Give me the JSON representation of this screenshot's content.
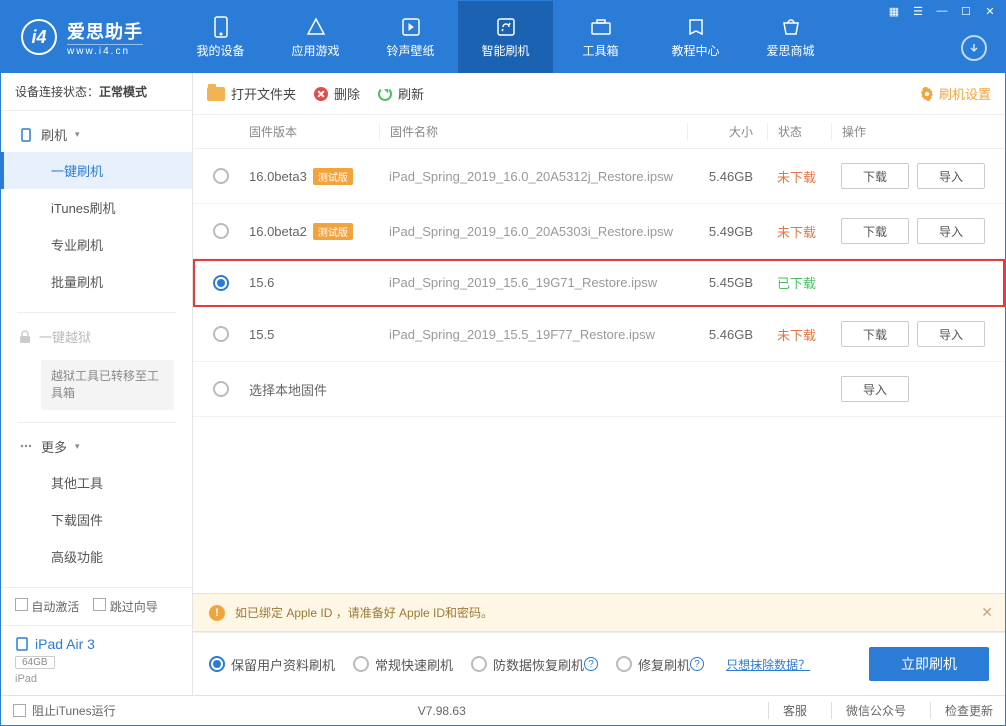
{
  "header": {
    "logo_abbr": "i4",
    "logo_cn": "爱思助手",
    "logo_en": "www.i4.cn",
    "nav": [
      {
        "label": "我的设备"
      },
      {
        "label": "应用游戏"
      },
      {
        "label": "铃声壁纸"
      },
      {
        "label": "智能刷机"
      },
      {
        "label": "工具箱"
      },
      {
        "label": "教程中心"
      },
      {
        "label": "爱思商城"
      }
    ]
  },
  "sidebar": {
    "conn_prefix": "设备连接状态：",
    "conn_mode": "正常模式",
    "group_flash": "刷机",
    "items_flash": [
      "一键刷机",
      "iTunes刷机",
      "专业刷机",
      "批量刷机"
    ],
    "group_jailbreak": "一键越狱",
    "jailbreak_note": "越狱工具已转移至工具箱",
    "group_more": "更多",
    "items_more": [
      "其他工具",
      "下载固件",
      "高级功能"
    ],
    "auto_activate": "自动激活",
    "skip_wizard": "跳过向导",
    "device_name": "iPad Air 3",
    "device_cap": "64GB",
    "device_type": "iPad"
  },
  "toolbar": {
    "open": "打开文件夹",
    "delete": "删除",
    "refresh": "刷新",
    "settings": "刷机设置"
  },
  "table": {
    "h_ver": "固件版本",
    "h_name": "固件名称",
    "h_size": "大小",
    "h_status": "状态",
    "h_ops": "操作",
    "badge_beta": "测试版",
    "btn_download": "下载",
    "btn_import": "导入",
    "status_not": "未下载",
    "status_done": "已下载",
    "rows": [
      {
        "ver": "16.0beta3",
        "beta": true,
        "name": "iPad_Spring_2019_16.0_20A5312j_Restore.ipsw",
        "size": "5.46GB",
        "status": "not",
        "ops": true
      },
      {
        "ver": "16.0beta2",
        "beta": true,
        "name": "iPad_Spring_2019_16.0_20A5303i_Restore.ipsw",
        "size": "5.49GB",
        "status": "not",
        "ops": true
      },
      {
        "ver": "15.6",
        "beta": false,
        "name": "iPad_Spring_2019_15.6_19G71_Restore.ipsw",
        "size": "5.45GB",
        "status": "done",
        "ops": false,
        "selected": true,
        "highlight": true
      },
      {
        "ver": "15.5",
        "beta": false,
        "name": "iPad_Spring_2019_15.5_19F77_Restore.ipsw",
        "size": "5.46GB",
        "status": "not",
        "ops": true
      }
    ],
    "local_row": "选择本地固件"
  },
  "notice": "如已绑定 Apple ID ，请准备好 Apple ID和密码。",
  "options": {
    "opt1": "保留用户资料刷机",
    "opt2": "常规快速刷机",
    "opt3": "防数据恢复刷机",
    "opt4": "修复刷机",
    "link": "只想抹除数据？",
    "primary": "立即刷机"
  },
  "statusbar": {
    "block_itunes": "阻止iTunes运行",
    "version": "V7.98.63",
    "cs": "客服",
    "wechat": "微信公众号",
    "update": "检查更新"
  }
}
